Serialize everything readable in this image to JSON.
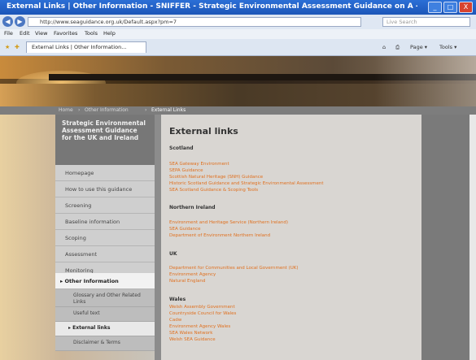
{
  "window": {
    "title": "External Links | Other Information - SNIFFER - Strategic Environmental Assessment Guidance on A - Win...",
    "minimize": "_",
    "maximize": "□",
    "close": "X"
  },
  "address": {
    "url": "http://www.seaguidance.org.uk/Default.aspx?pm=7",
    "search_placeholder": "Live Search"
  },
  "menu": [
    "File",
    "Edit",
    "View",
    "Favorites",
    "Tools",
    "Help"
  ],
  "tab": {
    "label": "External Links | Other Information..."
  },
  "commands": [
    "Page ▾",
    "Tools ▾"
  ],
  "breadcrumb": [
    "Home",
    "Other Information",
    "External Links"
  ],
  "site_title": "Strategic Environmental Assessment Guidance for the UK and Ireland",
  "sidebar": {
    "items": [
      "Homepage",
      "How to use this guidance",
      "Screening",
      "Baseline information",
      "Scoping",
      "Assessment",
      "Monitoring"
    ],
    "active": "Other Information",
    "subitems": [
      "Glossary and Other Related Links",
      "Useful text"
    ],
    "active_sub": "External links",
    "last_sub": "Disclaimer & Terms"
  },
  "main": {
    "heading": "External links",
    "sections": [
      {
        "title": "Scotland",
        "links": [
          "SEA Gateway Environment",
          "SEPA Guidance",
          "Scottish Natural Heritage (SNH) Guidance",
          "Historic Scotland Guidance and Strategic Environmental Assessment",
          "SEA Scotland Guidance & Scoping Tools"
        ]
      },
      {
        "title": "Northern Ireland",
        "links": [
          "Environment and Heritage Service (Northern Ireland)",
          "SEA Guidance",
          "Department of Environment Northern Ireland"
        ]
      },
      {
        "title": "UK",
        "links": [
          "Department for Communities and Local Government (UK)",
          "Environment Agency",
          "Natural England"
        ]
      },
      {
        "title": "Wales",
        "links": [
          "Welsh Assembly Government",
          "Countryside Council for Wales",
          "Cadw",
          "Environment Agency Wales",
          "SEA Wales Network",
          "Welsh SEA Guidance"
        ]
      }
    ]
  }
}
